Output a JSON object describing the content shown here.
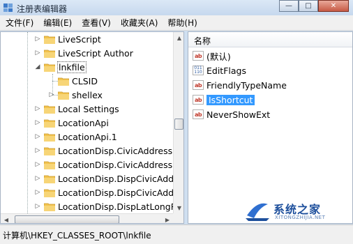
{
  "window": {
    "title": "注册表编辑器"
  },
  "caption_buttons": {
    "minimize": "—",
    "maximize": "□",
    "close": "✕"
  },
  "menu": [
    "文件(F)",
    "编辑(E)",
    "查看(V)",
    "收藏夹(A)",
    "帮助(H)"
  ],
  "tree": {
    "items": [
      {
        "label": "LiveScript",
        "expandable": true
      },
      {
        "label": "LiveScript Author",
        "expandable": true
      },
      {
        "label": "lnkfile",
        "expandable": true,
        "expanded": true,
        "selected": true
      },
      {
        "label": "CLSID",
        "expandable": false,
        "child": true
      },
      {
        "label": "shellex",
        "expandable": true,
        "child": true
      },
      {
        "label": "Local Settings",
        "expandable": true
      },
      {
        "label": "LocationApi",
        "expandable": true
      },
      {
        "label": "LocationApi.1",
        "expandable": true
      },
      {
        "label": "LocationDisp.CivicAddressRe",
        "expandable": true
      },
      {
        "label": "LocationDisp.CivicAddressRe",
        "expandable": true
      },
      {
        "label": "LocationDisp.DispCivicAddre",
        "expandable": true
      },
      {
        "label": "LocationDisp.DispCivicAddre",
        "expandable": true
      },
      {
        "label": "LocationDisp.DispLatLongRe",
        "expandable": true
      }
    ]
  },
  "values_pane": {
    "column_header": "名称",
    "items": [
      {
        "label": "(默认)",
        "type": "string"
      },
      {
        "label": "EditFlags",
        "type": "binary"
      },
      {
        "label": "FriendlyTypeName",
        "type": "string"
      },
      {
        "label": "IsShortcut",
        "type": "string",
        "selected": true
      },
      {
        "label": "NeverShowExt",
        "type": "string"
      }
    ]
  },
  "icons": {
    "string": "ab",
    "binary": "011\n110"
  },
  "watermark": {
    "name": "系统之家",
    "url": "XITONGZHIJIA.NET"
  },
  "statusbar": {
    "path": "计算机\\HKEY_CLASSES_ROOT\\lnkfile"
  },
  "colors": {
    "selection": "#3399ff",
    "folder": "#f2c34e"
  }
}
